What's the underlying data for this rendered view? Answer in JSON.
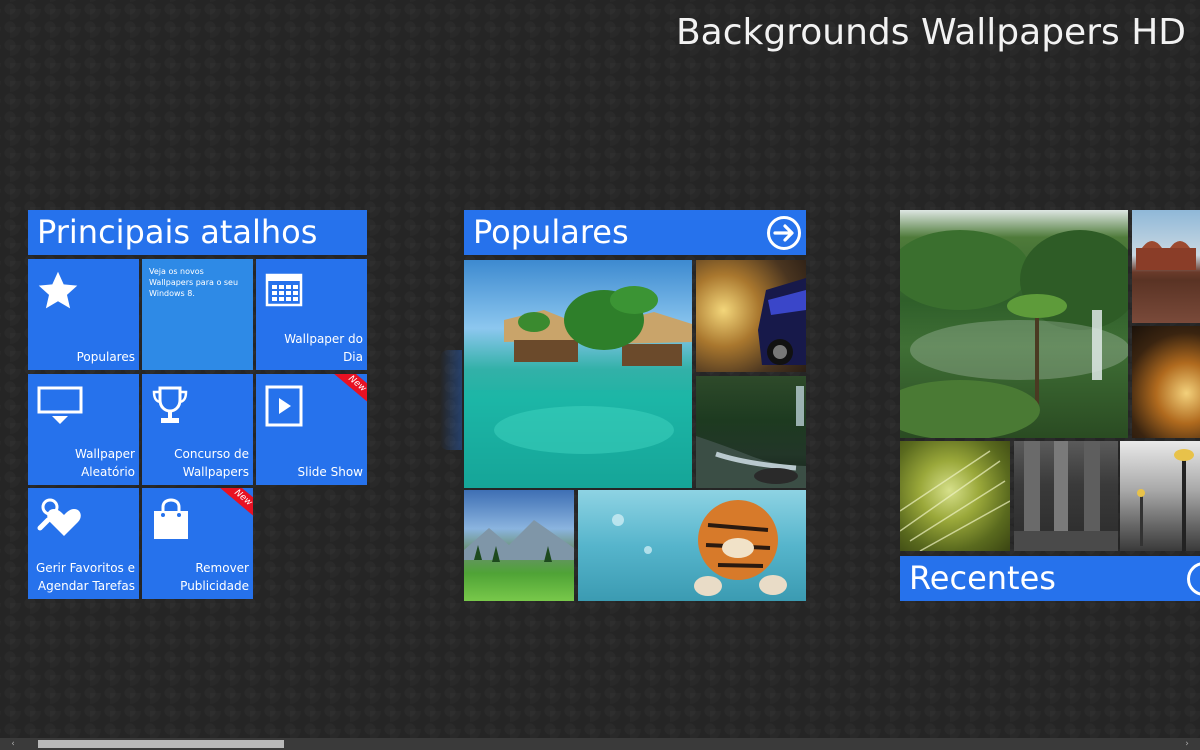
{
  "app": {
    "title": "Backgrounds Wallpapers HD"
  },
  "shortcuts": {
    "header": "Principais atalhos",
    "tiles": [
      {
        "label": "Populares",
        "icon": "star-icon"
      },
      {
        "promo_text": "Veja os novos Wallpapers para o seu Windows 8."
      },
      {
        "label": "Wallpaper do Dia",
        "icon": "calendar-icon"
      },
      {
        "label": "Wallpaper Aleatório",
        "icon": "monitor-icon"
      },
      {
        "label": "Concurso de Wallpapers",
        "icon": "trophy-icon"
      },
      {
        "label": "Slide Show",
        "icon": "play-icon",
        "badge": "New"
      },
      {
        "label": "Gerir Favoritos e Agendar Tarefas",
        "icon": "heart-wrench-icon"
      },
      {
        "label": "Remover Publicidade",
        "icon": "shopping-bag-icon",
        "badge": "New"
      }
    ]
  },
  "popular": {
    "header": "Populares",
    "header_icon": "arrow-right-circle-icon",
    "photos": [
      "tropical-bungalows",
      "blue-sports-car",
      "forest-stream",
      "mountain-meadow",
      "swimming-tiger"
    ]
  },
  "recent": {
    "header": "Recentes",
    "photos": [
      "rainforest-waterfall",
      "palace-reflection",
      "flower-closeup",
      "green-plant-macro",
      "stone-building",
      "street-lamps"
    ]
  },
  "colors": {
    "accent": "#2672ec",
    "badge": "#e81123",
    "background": "#252525"
  },
  "scrollbar": {
    "left_arrow": "‹",
    "right_arrow": "›"
  }
}
